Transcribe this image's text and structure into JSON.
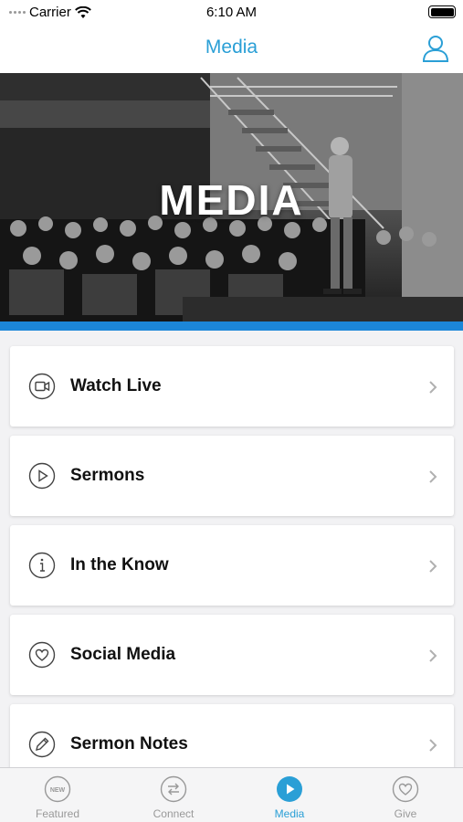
{
  "status_bar": {
    "carrier": "Carrier",
    "time": "6:10 AM"
  },
  "nav": {
    "title": "Media",
    "profile_icon": "person-icon"
  },
  "hero": {
    "title": "MEDIA"
  },
  "menu": {
    "items": [
      {
        "label": "Watch Live",
        "icon": "video-camera-icon"
      },
      {
        "label": "Sermons",
        "icon": "play-icon"
      },
      {
        "label": "In the Know",
        "icon": "info-icon"
      },
      {
        "label": "Social Media",
        "icon": "heart-icon"
      },
      {
        "label": "Sermon Notes",
        "icon": "pencil-icon"
      }
    ]
  },
  "tabs": {
    "items": [
      {
        "label": "Featured",
        "icon": "new-badge-icon",
        "badge_text": "NEW"
      },
      {
        "label": "Connect",
        "icon": "arrows-exchange-icon"
      },
      {
        "label": "Media",
        "icon": "play-icon",
        "active": true
      },
      {
        "label": "Give",
        "icon": "heart-icon"
      }
    ]
  },
  "colors": {
    "accent": "#2a9fd6",
    "hero_bar": "#1c86d8",
    "inactive": "#999999"
  }
}
